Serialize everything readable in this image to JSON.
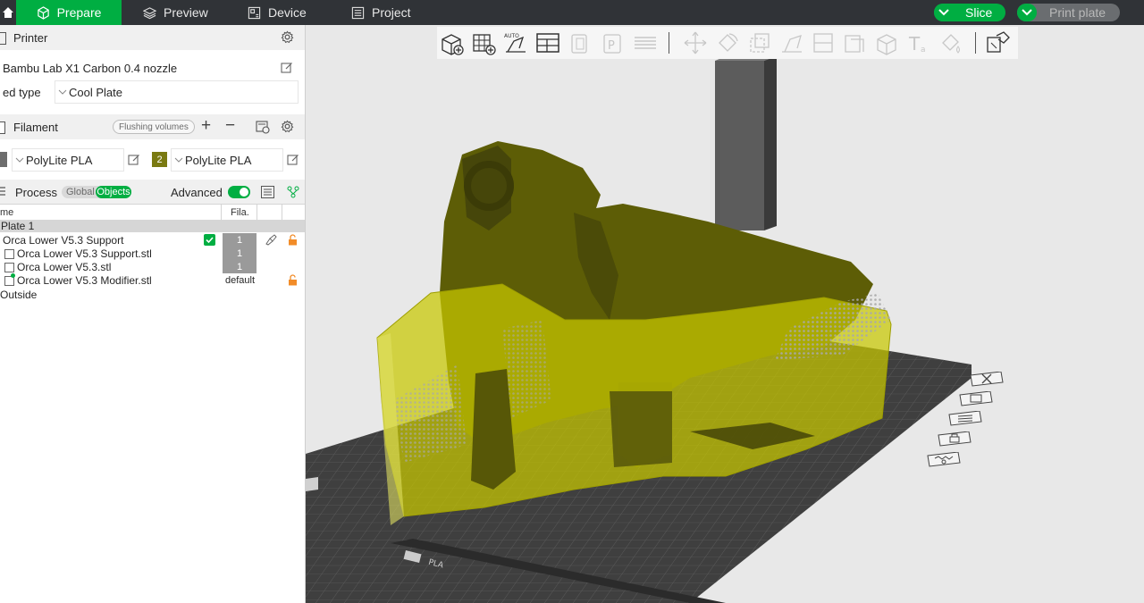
{
  "tabs": [
    {
      "label": "Prepare",
      "icon": "cube-icon",
      "active": true
    },
    {
      "label": "Preview",
      "icon": "layers-icon",
      "active": false
    },
    {
      "label": "Device",
      "icon": "device-icon",
      "active": false
    },
    {
      "label": "Project",
      "icon": "project-icon",
      "active": false
    }
  ],
  "actions": {
    "slice": "Slice",
    "print": "Print plate"
  },
  "printer": {
    "section_title": "Printer",
    "name": "Bambu Lab X1 Carbon 0.4 nozzle",
    "bed_label": "ed type",
    "bed_value": "Cool Plate"
  },
  "filament": {
    "section_title": "Filament",
    "flush_button": "Flushing volumes",
    "slots": [
      {
        "index": "",
        "name": "PolyLite PLA",
        "color": "#6d6d6d"
      },
      {
        "index": "2",
        "name": "PolyLite PLA",
        "color": "#7a7a12"
      }
    ]
  },
  "process": {
    "section_title": "Process",
    "global_label": "Global",
    "objects_label": "Objects",
    "advanced_label": "Advanced",
    "advanced_on": true
  },
  "tree": {
    "col_name": "me",
    "col_fila": "Fila.",
    "plate": "Plate 1",
    "rows": [
      {
        "name": "Orca Lower V5.3 Support",
        "fila": "1"
      },
      {
        "name": "Orca Lower V5.3 Support.stl",
        "fila": "1"
      },
      {
        "name": "Orca Lower V5.3.stl",
        "fila": "1"
      },
      {
        "name": "Orca Lower V5.3 Modifier.stl",
        "fila": "default"
      }
    ],
    "outside": "Outside"
  },
  "plate_label": "PLA",
  "colors": {
    "accent": "#00ae42",
    "topbar": "#303337",
    "model": "#c8c800",
    "model_dark": "#5d5d06"
  }
}
